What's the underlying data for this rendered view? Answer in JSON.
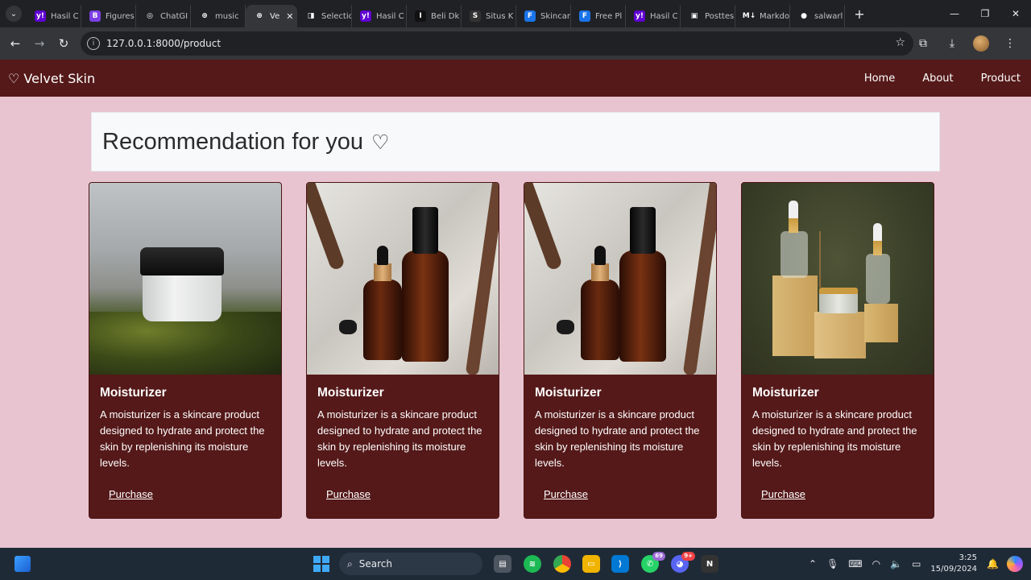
{
  "browser": {
    "tabs": [
      {
        "label": "Hasil C",
        "icon": "yahoo-icon",
        "color": "#6001d2",
        "glyph": "y!"
      },
      {
        "label": "Figures",
        "icon": "b-icon",
        "color": "#7b3fe4",
        "glyph": "B"
      },
      {
        "label": "ChatGI",
        "icon": "chatgpt-icon",
        "color": "#202124",
        "glyph": "◎"
      },
      {
        "label": "music",
        "icon": "globe-icon",
        "color": "#202124",
        "glyph": "⊕"
      },
      {
        "label": "Ve",
        "icon": "globe-icon",
        "color": "#35363a",
        "glyph": "⊕",
        "active": true
      },
      {
        "label": "Selectio",
        "icon": "flag-icon",
        "color": "#202124",
        "glyph": "◨"
      },
      {
        "label": "Hasil C",
        "icon": "yahoo-icon",
        "color": "#6001d2",
        "glyph": "y!"
      },
      {
        "label": "Beli Dk",
        "icon": "shop-icon",
        "color": "#111111",
        "glyph": "I"
      },
      {
        "label": "Situs K",
        "icon": "s-icon",
        "color": "#333333",
        "glyph": "S"
      },
      {
        "label": "Skincar",
        "icon": "f-icon",
        "color": "#1a73e8",
        "glyph": "F"
      },
      {
        "label": "Free Pl",
        "icon": "f-icon",
        "color": "#1a73e8",
        "glyph": "F"
      },
      {
        "label": "Hasil C",
        "icon": "yahoo-icon",
        "color": "#6001d2",
        "glyph": "y!"
      },
      {
        "label": "Posttes",
        "icon": "image-icon",
        "color": "#202124",
        "glyph": "▣"
      },
      {
        "label": "Markdo",
        "icon": "markdown-icon",
        "color": "#202124",
        "glyph": "M↓"
      },
      {
        "label": "salwarl",
        "icon": "github-icon",
        "color": "#202124",
        "glyph": "●"
      }
    ],
    "url": "127.0.0.1:8000/product"
  },
  "site": {
    "brand": "♡ Velvet Skin",
    "nav": [
      "Home",
      "About",
      "Product"
    ],
    "recommendation_title": "Recommendation for you",
    "recommendation_heart": "♡"
  },
  "products": [
    {
      "title": "Moisturizer",
      "description": "A moisturizer is a skincare product designed to hydrate and protect the skin by replenishing its moisture levels.",
      "button": "Purchase",
      "image": "jar-on-moss"
    },
    {
      "title": "Moisturizer",
      "description": "A moisturizer is a skincare product designed to hydrate and protect the skin by replenishing its moisture levels.",
      "button": "Purchase",
      "image": "amber-bottles"
    },
    {
      "title": "Moisturizer",
      "description": "A moisturizer is a skincare product designed to hydrate and protect the skin by replenishing its moisture levels.",
      "button": "Purchase",
      "image": "amber-bottles"
    },
    {
      "title": "Moisturizer",
      "description": "A moisturizer is a skincare product designed to hydrate and protect the skin by replenishing its moisture levels.",
      "button": "Purchase",
      "image": "droppers-on-wood"
    }
  ],
  "taskbar": {
    "search_label": "Search",
    "whatsapp_badge": "69",
    "discord_badge": "9+",
    "time": "3:25",
    "date": "15/09/2024"
  },
  "colors": {
    "navbar": "#551919",
    "page_bg": "#e8c4d0",
    "card_bg": "#551919"
  }
}
